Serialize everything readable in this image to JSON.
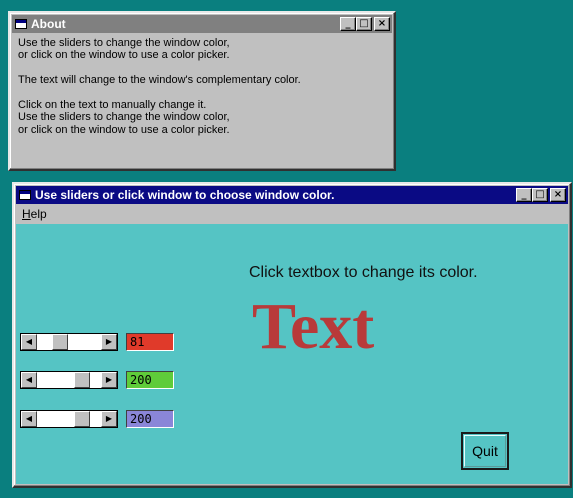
{
  "about_window": {
    "title": "About",
    "lines": [
      "Use the sliders to change the window color,",
      "or click on the window to use a color picker.",
      "",
      "The text will change to the window's complementary color.",
      "",
      "Click on the text to manually change it.",
      "Use the sliders to change the window color,",
      "or click on the window to use a color picker."
    ]
  },
  "main_window": {
    "title": "Use sliders or click window to choose window color.",
    "menu": [
      {
        "label": "Help",
        "mnemonic": "H"
      }
    ],
    "hint": "Click textbox to change its color.",
    "sample_text": "Text",
    "sample_text_color": "#b83a3a",
    "window_color": "#55c4c4",
    "sliders": [
      {
        "name": "red",
        "value": "81",
        "level_fraction": 0.32,
        "box_color": "#e03a2a"
      },
      {
        "name": "green",
        "value": "200",
        "level_fraction": 0.78,
        "box_color": "#5fcc3a"
      },
      {
        "name": "blue",
        "value": "200",
        "level_fraction": 0.78,
        "box_color": "#8a86d8"
      }
    ],
    "quit_label": "Quit"
  },
  "titlebar_buttons": {
    "minimize": "_",
    "maximize": "□",
    "close": "×"
  },
  "desktop_color": "#0a7f7f"
}
